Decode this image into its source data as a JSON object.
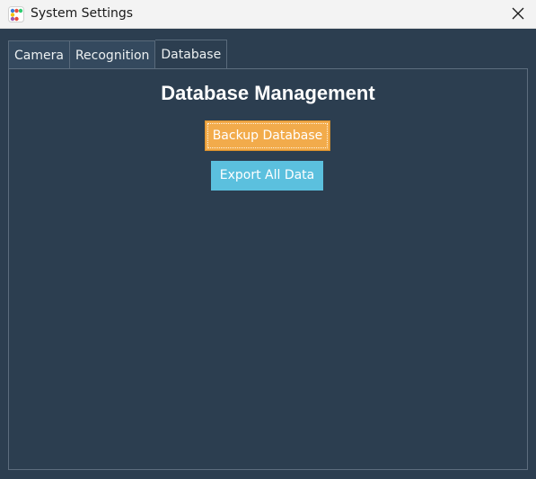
{
  "window": {
    "title": "System Settings",
    "icon": "app-dots-icon",
    "close_icon": "close-icon"
  },
  "tabs": [
    {
      "label": "Camera",
      "active": false
    },
    {
      "label": "Recognition",
      "active": false
    },
    {
      "label": "Database",
      "active": true
    }
  ],
  "database": {
    "heading": "Database Management",
    "backup_button": "Backup Database",
    "export_button": "Export All Data"
  },
  "colors": {
    "background": "#2c3e50",
    "backup_button": "#f2ab4b",
    "export_button": "#5bc0de"
  }
}
